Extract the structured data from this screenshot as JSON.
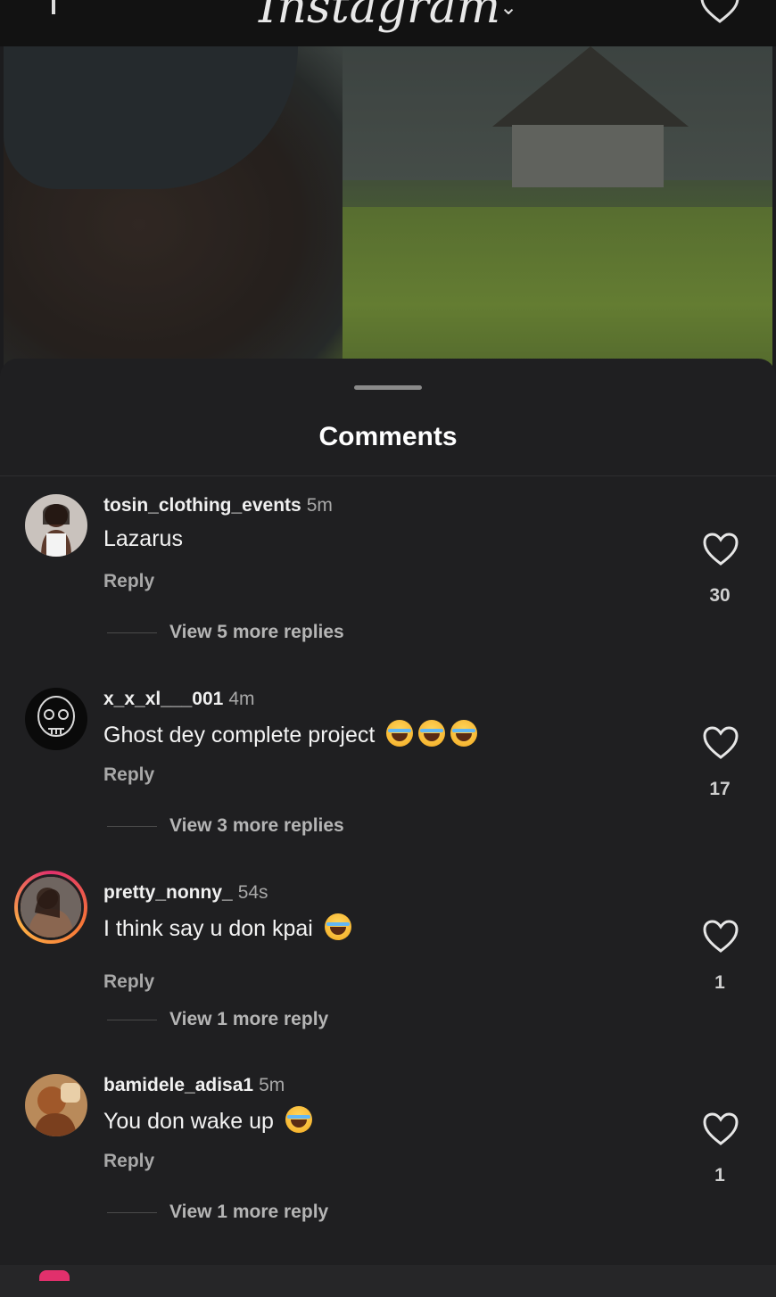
{
  "app": {
    "title": "Instagram"
  },
  "sheet": {
    "title": "Comments"
  },
  "comments": [
    {
      "username": "tosin_clothing_events",
      "time": "5m",
      "text": "Lazarus",
      "emojis": 0,
      "reply_label": "Reply",
      "likes": "30",
      "view_more": "View 5 more replies",
      "avatar_icon": "woman-white-top-avatar"
    },
    {
      "username": "x_x_xl___001",
      "time": "4m",
      "text": "Ghost dey complete project",
      "emojis": 3,
      "reply_label": "Reply",
      "likes": "17",
      "view_more": "View 3 more replies",
      "avatar_icon": "skull-avatar"
    },
    {
      "username": "pretty_nonny_",
      "time": "54s",
      "text": "I think say u don kpai",
      "emojis": 1,
      "reply_label": "Reply",
      "likes": "1",
      "view_more": "View 1 more reply",
      "avatar_icon": "story-ring-avatar"
    },
    {
      "username": "bamidele_adisa1",
      "time": "5m",
      "text": "You don wake up",
      "emojis": 1,
      "reply_label": "Reply",
      "likes": "1",
      "view_more": "View 1 more reply",
      "avatar_icon": "avatar"
    }
  ],
  "colors": {
    "background": "#1f1f21",
    "muted_text": "#a8a8a8",
    "story_ring": "#e1306c"
  }
}
